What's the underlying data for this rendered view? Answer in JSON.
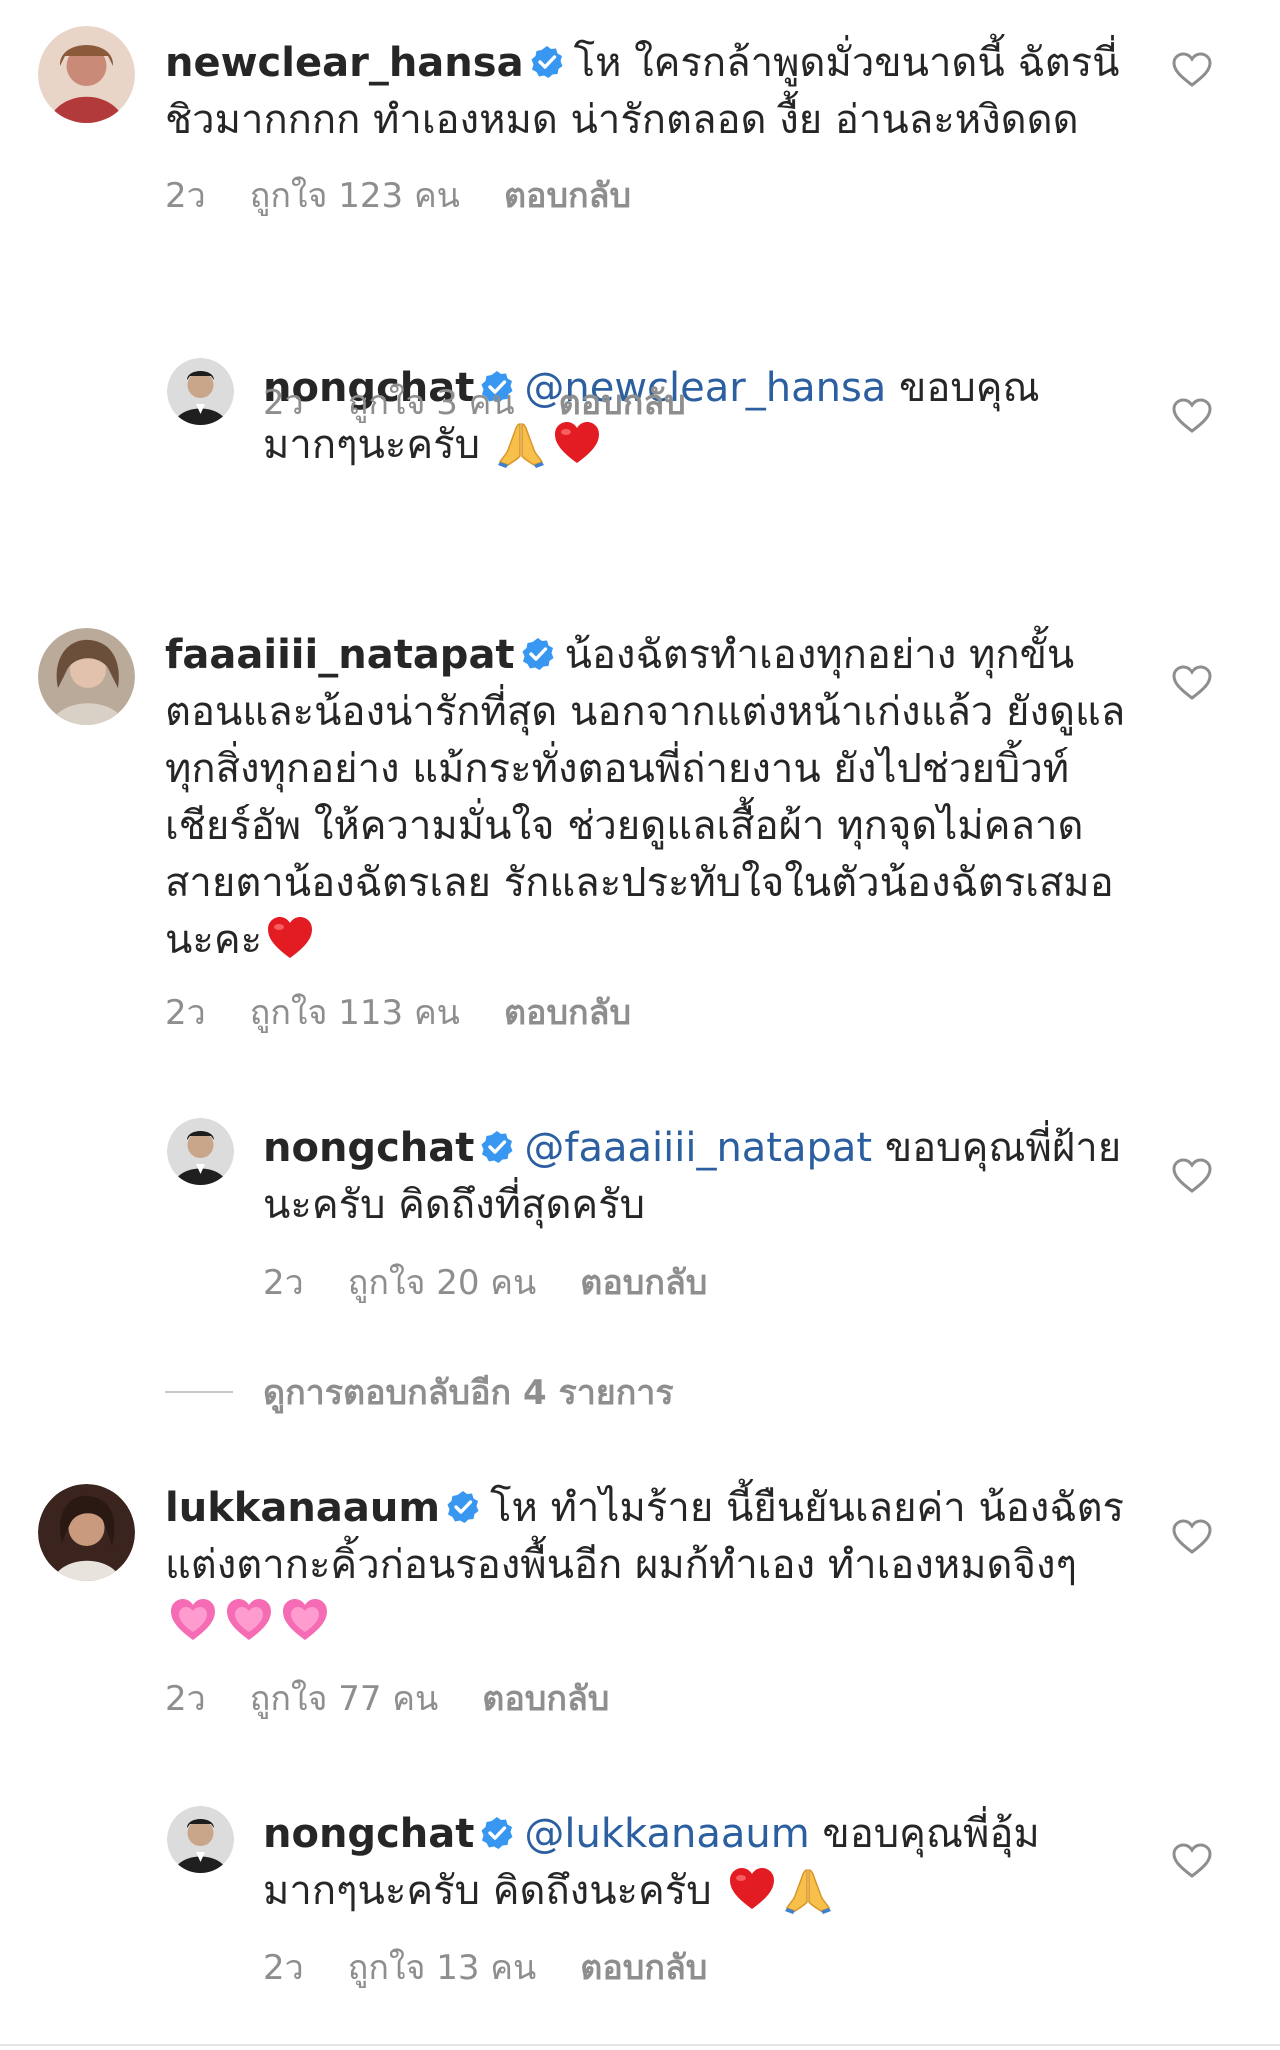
{
  "comments": [
    {
      "username": "newclear_hansa",
      "text": "โห ใครกล้าพูดมั่วขนาดนี้ ฉัตรนี่ชิวมากกกก ทำเองหมด น่ารักตลอด งื้ย อ่านละหงิดดด",
      "age": "2ว",
      "likes": "ถูกใจ 123 คน",
      "reply_label": "ตอบกลับ",
      "avatar_color": "#c98a78"
    },
    {
      "username": "nongchat",
      "mention": "@newclear_hansa",
      "text": "ขอบคุณมากๆนะครับ",
      "emojis": [
        "praying-hands",
        "red-heart"
      ],
      "age": "2ว",
      "likes": "ถูกใจ 3 คน",
      "reply_label": "ตอบกลับ",
      "avatar_color": "#2d2d2d"
    },
    {
      "username": "faaaiiii_natapat",
      "text": "น้องฉัตรทำเองทุกอย่าง ทุกขั้นตอนและน้องน่ารักที่สุด นอกจากแต่งหน้าเก่งแล้ว ยังดูแลทุกสิ่งทุกอย่าง แม้กระทั่งตอนพี่ถ่ายงาน ยังไปช่วยบิ้วท์ เชียร์อัพ ให้ความมั่นใจ ช่วยดูแลเสื้อผ้า ทุกจุดไม่คลาดสายตาน้องฉัตรเลย รักและประทับใจในตัวน้องฉัตรเสมอนะคะ",
      "emojis": [
        "red-heart"
      ],
      "age": "2ว",
      "likes": "ถูกใจ 113 คน",
      "reply_label": "ตอบกลับ",
      "avatar_color": "#8a7a6a"
    },
    {
      "username": "nongchat",
      "mention": "@faaaiiii_natapat",
      "text": "ขอบคุณพี่ฝ้ายนะครับ คิดถึงที่สุดครับ",
      "age": "2ว",
      "likes": "ถูกใจ 20 คน",
      "reply_label": "ตอบกลับ",
      "avatar_color": "#2d2d2d"
    },
    {
      "username": "lukkanaaum",
      "text": "โห ทำไมร้าย นี้ยืนยันเลยค่า น้องฉัตรแต่งตากะคิ้วก่อนรองพื้นอีก ผมก้ทำเอง ทำเองหมดจิงๆ",
      "emojis": [
        "growing-heart",
        "growing-heart",
        "growing-heart"
      ],
      "age": "2ว",
      "likes": "ถูกใจ 77 คน",
      "reply_label": "ตอบกลับ",
      "avatar_color": "#5a3a2e"
    },
    {
      "username": "nongchat",
      "mention": "@lukkanaaum",
      "text": "ขอบคุณพี่อุ้มมากๆนะครับ คิดถึงนะครับ",
      "emojis": [
        "red-heart",
        "praying-hands"
      ],
      "age": "2ว",
      "likes": "ถูกใจ 13 คน",
      "reply_label": "ตอบกลับ",
      "avatar_color": "#2d2d2d"
    }
  ],
  "view_more_replies": "ดูการตอบกลับอีก 4 รายการ",
  "colors": {
    "text": "#262626",
    "meta": "#8e8e8e",
    "mention": "#2b5fa0",
    "verified": "#3897f0"
  }
}
